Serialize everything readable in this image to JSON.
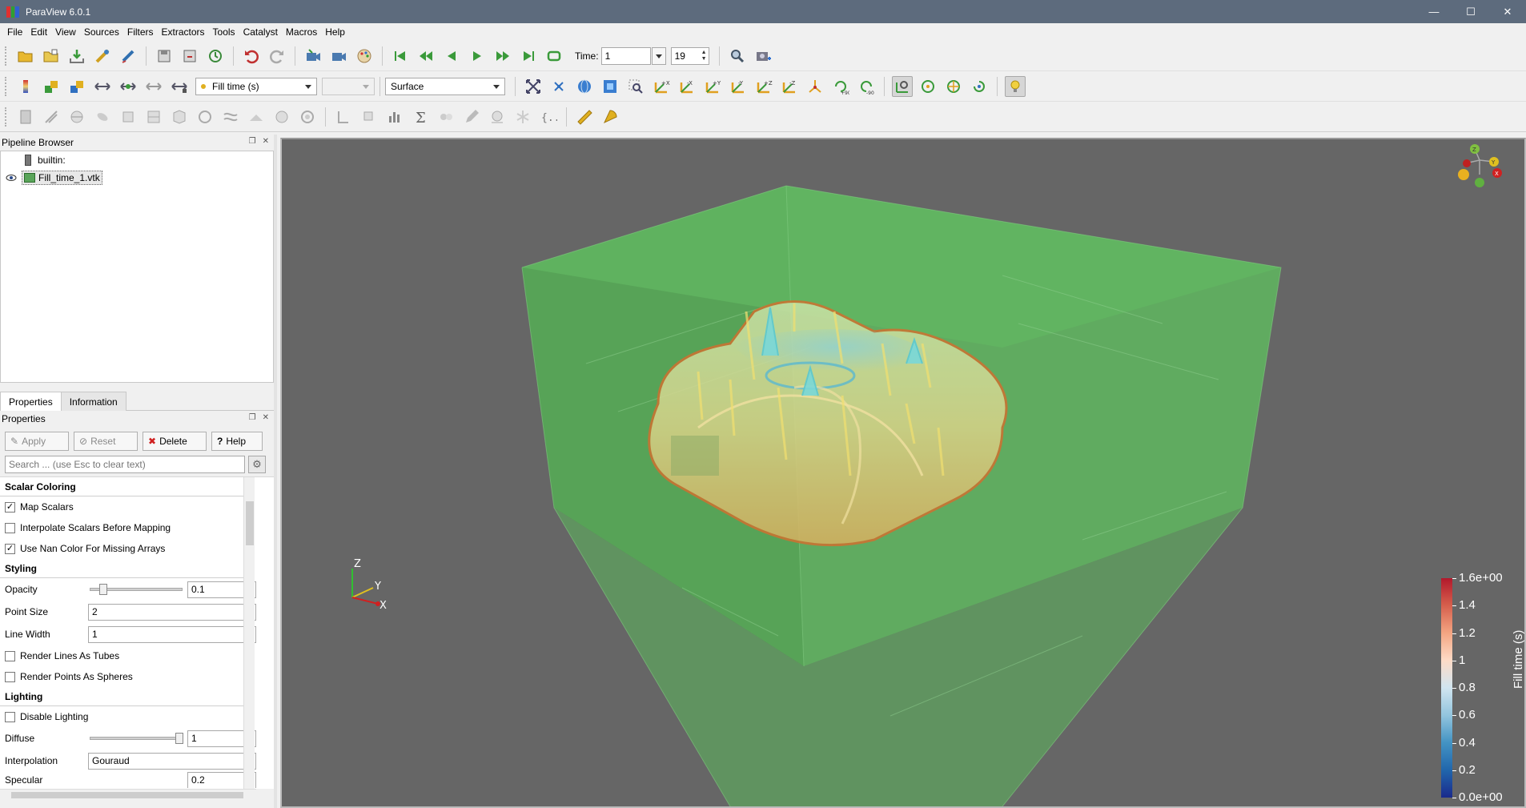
{
  "window": {
    "title": "ParaView 6.0.1",
    "minimize": "—",
    "maximize": "☐",
    "close": "✕"
  },
  "menu": [
    "File",
    "Edit",
    "View",
    "Sources",
    "Filters",
    "Extractors",
    "Tools",
    "Catalyst",
    "Macros",
    "Help"
  ],
  "toolbar_main": {
    "time_label": "Time:",
    "time_value": "1",
    "timestep_value": "19"
  },
  "toolbar_display": {
    "color_array": "Fill time (s)",
    "component": "",
    "representation": "Surface"
  },
  "pipeline_browser": {
    "title": "Pipeline Browser",
    "items": [
      {
        "label": "builtin:"
      },
      {
        "label": "Fill_time_1.vtk"
      }
    ]
  },
  "tabs": [
    "Properties",
    "Information"
  ],
  "properties": {
    "title": "Properties",
    "buttons": {
      "apply": "Apply",
      "reset": "Reset",
      "delete": "Delete",
      "help": "Help"
    },
    "search_placeholder": "Search ... (use Esc to clear text)",
    "sections": {
      "scalar_coloring": "Scalar Coloring",
      "styling": "Styling",
      "lighting": "Lighting"
    },
    "map_scalars": {
      "label": "Map Scalars",
      "checked": true
    },
    "interpolate_scalars": {
      "label": "Interpolate Scalars Before Mapping",
      "checked": false
    },
    "nan_color": {
      "label": "Use Nan Color For Missing Arrays",
      "checked": true
    },
    "opacity": {
      "label": "Opacity",
      "value": "0.1",
      "level": 0.1
    },
    "point_size": {
      "label": "Point Size",
      "value": "2"
    },
    "line_width": {
      "label": "Line Width",
      "value": "1"
    },
    "render_tubes": {
      "label": "Render Lines As Tubes",
      "checked": false
    },
    "render_spheres": {
      "label": "Render Points As Spheres",
      "checked": false
    },
    "disable_lighting": {
      "label": "Disable Lighting",
      "checked": false
    },
    "diffuse": {
      "label": "Diffuse",
      "value": "1",
      "level": 1.0
    },
    "interpolation": {
      "label": "Interpolation",
      "value": "Gouraud"
    },
    "specular": {
      "label": "Specular",
      "value": "0.2"
    }
  },
  "viewport": {
    "background": "#666666",
    "axes_labels": {
      "x": "X",
      "y": "Y",
      "z": "Z"
    },
    "colorbar": {
      "title": "Fill time (s)",
      "ticks": [
        "1.6e+00",
        "1.4",
        "1.2",
        "1",
        "0.8",
        "0.6",
        "0.4",
        "0.2",
        "0.0e+00"
      ],
      "colors": [
        "#b2182b",
        "#d6604d",
        "#f4a582",
        "#fddbc7",
        "#d1e5f0",
        "#92c5de",
        "#4393c3",
        "#2166ac",
        "#1a2a8c"
      ]
    },
    "box_color": "#5fb35f"
  }
}
